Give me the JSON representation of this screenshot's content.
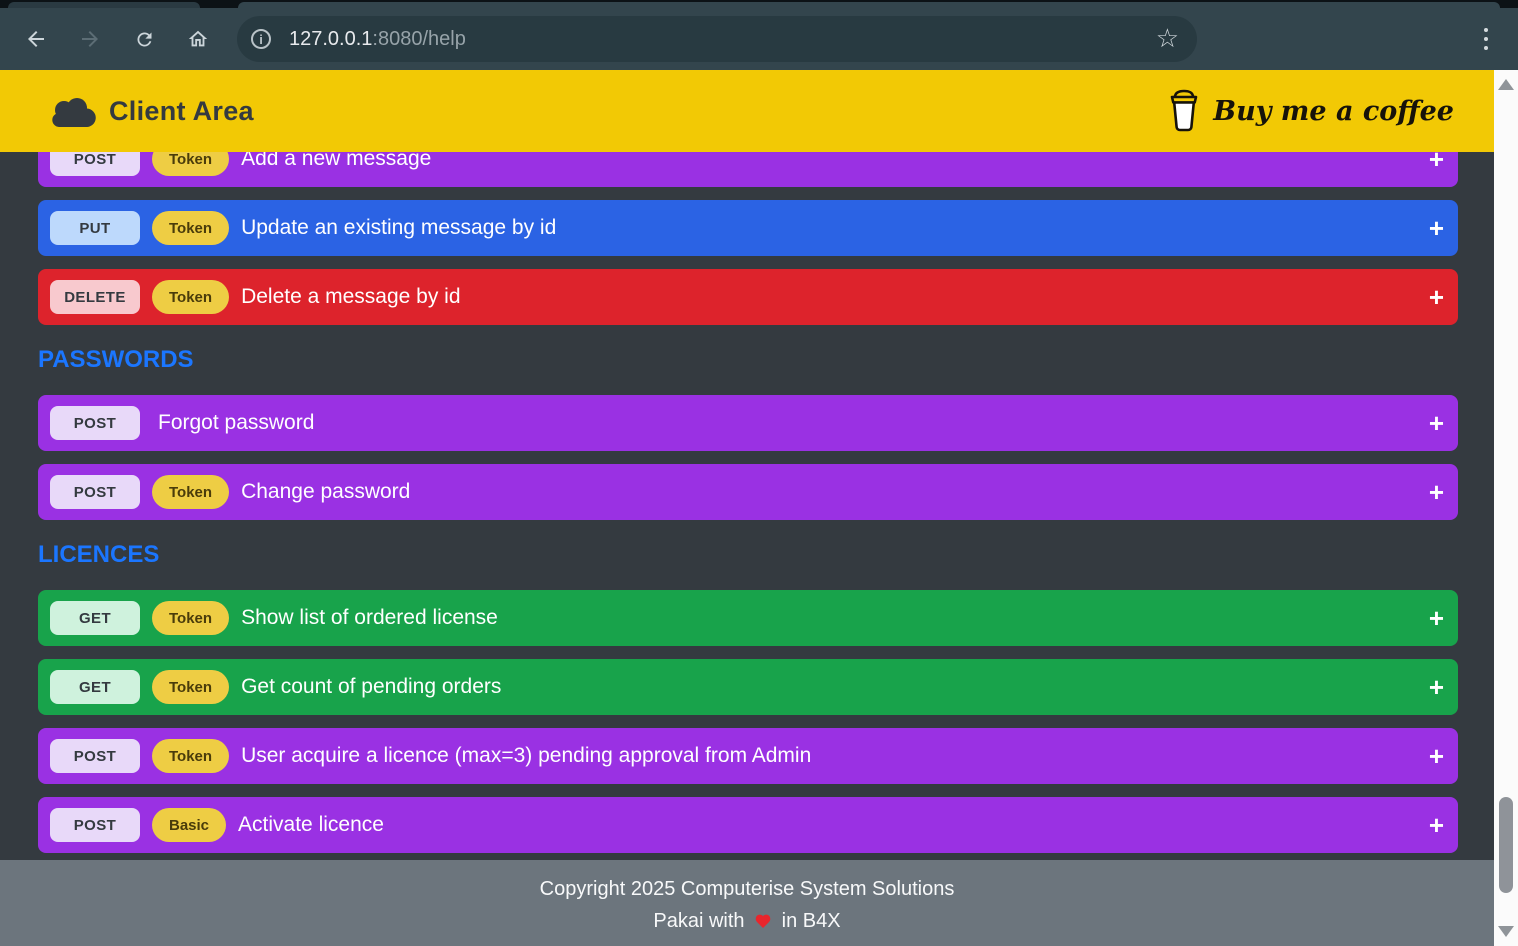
{
  "chrome": {
    "url_host": "127.0.0.1",
    "url_rest": ":8080/help",
    "back_icon": "arrow-left",
    "forward_icon": "arrow-right",
    "reload_icon": "reload",
    "home_icon": "home",
    "info_glyph": "i",
    "star_glyph": "☆"
  },
  "header": {
    "title": "Client Area",
    "logo_icon": "cloud",
    "bmc_label": "Buy me a coffee",
    "bmc_icon": "coffee-cup"
  },
  "ui": {
    "expand_glyph": "+"
  },
  "palette": {
    "page_bg": "#343a40",
    "header_bg": "#f2c905",
    "section_title": "#1b76ff",
    "footer_bg": "#6c757d",
    "purple": "#9a31e3",
    "blue": "#2b63e4",
    "red": "#dd232c",
    "green": "#18a34b",
    "badge_post_bg": "#e8d9f9",
    "badge_put_bg": "#bdd9fc",
    "badge_delete_bg": "#f8c9ce",
    "badge_get_bg": "#cff2dd",
    "badge_text": "#343a40",
    "auth_bg": "#eecd44",
    "auth_text": "#4a3c0a",
    "heart": "#e8252c"
  },
  "sections": [
    {
      "title": null,
      "rows": [
        {
          "method": "POST",
          "auth": "Token",
          "title": "Add a new message",
          "color": "purple",
          "partial": true
        },
        {
          "method": "PUT",
          "auth": "Token",
          "title": "Update an existing message by id",
          "color": "blue"
        },
        {
          "method": "DELETE",
          "auth": "Token",
          "title": "Delete a message by id",
          "color": "red"
        }
      ]
    },
    {
      "title": "PASSWORDS",
      "rows": [
        {
          "method": "POST",
          "auth": null,
          "title": "Forgot password",
          "color": "purple"
        },
        {
          "method": "POST",
          "auth": "Token",
          "title": "Change password",
          "color": "purple"
        }
      ]
    },
    {
      "title": "LICENCES",
      "rows": [
        {
          "method": "GET",
          "auth": "Token",
          "title": "Show list of ordered license",
          "color": "green"
        },
        {
          "method": "GET",
          "auth": "Token",
          "title": "Get count of pending orders",
          "color": "green"
        },
        {
          "method": "POST",
          "auth": "Token",
          "title": "User acquire a licence (max=3) pending approval from Admin",
          "color": "purple"
        },
        {
          "method": "POST",
          "auth": "Basic",
          "title": "Activate licence",
          "color": "purple"
        }
      ]
    }
  ],
  "footer": {
    "line1": "Copyright 2025 Computerise System Solutions",
    "line2_prefix": "Pakai with",
    "line2_suffix": "in B4X"
  }
}
